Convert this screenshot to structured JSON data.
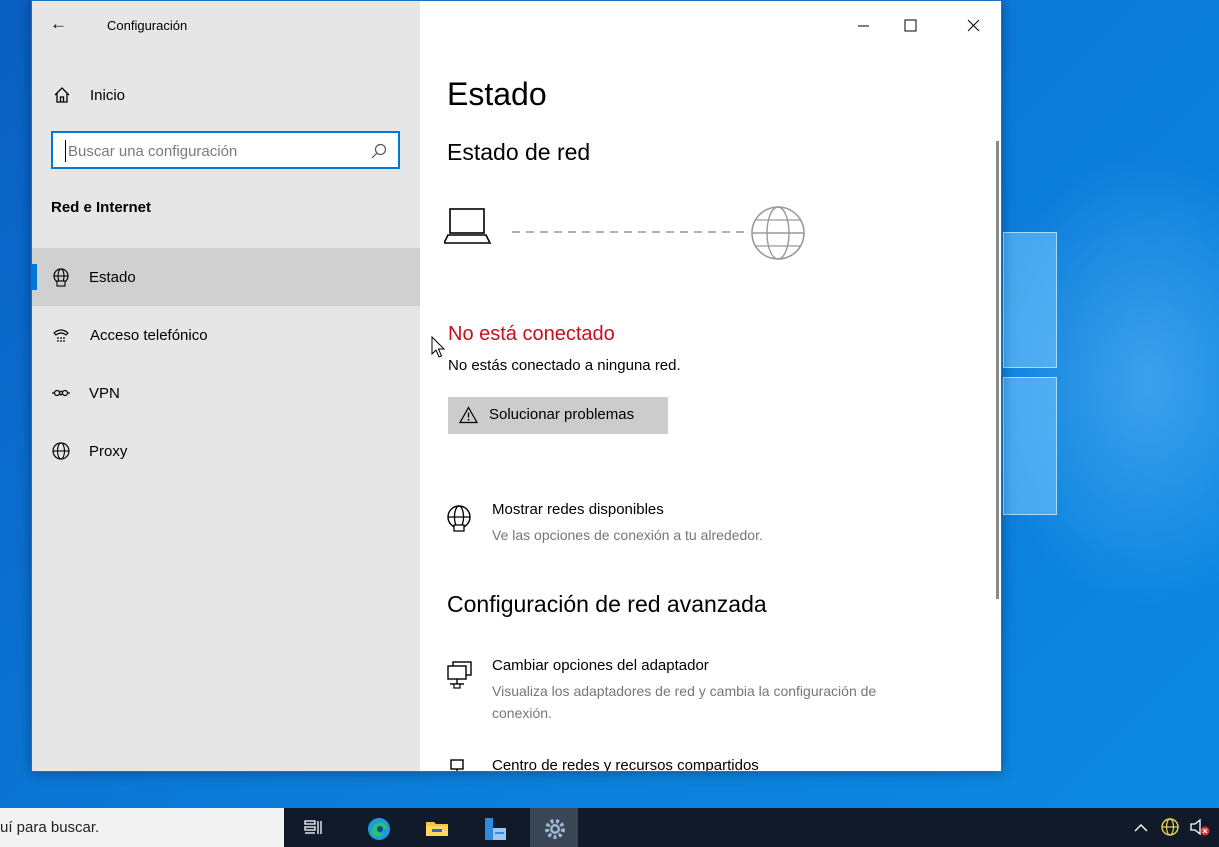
{
  "window": {
    "title": "Configuración",
    "controls": {
      "minimize": "—",
      "maximize": "☐",
      "close": "✕"
    }
  },
  "sidebar": {
    "home_label": "Inicio",
    "search_placeholder": "Buscar una configuración",
    "section_title": "Red e Internet",
    "items": [
      {
        "label": "Estado",
        "icon": "network-globe-icon",
        "active": true
      },
      {
        "label": "Acceso telefónico",
        "icon": "dialup-phone-icon",
        "active": false
      },
      {
        "label": "VPN",
        "icon": "vpn-icon",
        "active": false
      },
      {
        "label": "Proxy",
        "icon": "globe-icon",
        "active": false
      }
    ]
  },
  "main": {
    "page_title": "Estado",
    "network_status_heading": "Estado de red",
    "status_title": "No está conectado",
    "status_description": "No estás conectado a ninguna red.",
    "troubleshoot_label": "Solucionar problemas",
    "show_networks": {
      "title": "Mostrar redes disponibles",
      "description": "Ve las opciones de conexión a tu alrededor."
    },
    "advanced_heading": "Configuración de red avanzada",
    "adapter_options": {
      "title": "Cambiar opciones del adaptador",
      "description": "Visualiza los adaptadores de red y cambia la configuración de conexión."
    },
    "sharing_center": {
      "title": "Centro de redes y recursos compartidos"
    }
  },
  "taskbar": {
    "search_text": "uí para buscar.",
    "apps": [
      "task-view-icon",
      "edge-icon",
      "file-explorer-icon",
      "network-app-icon",
      "settings-icon"
    ]
  },
  "colors": {
    "accent": "#0078d7",
    "error": "#c50f1f",
    "sidebar_bg": "#e6e6e6"
  }
}
